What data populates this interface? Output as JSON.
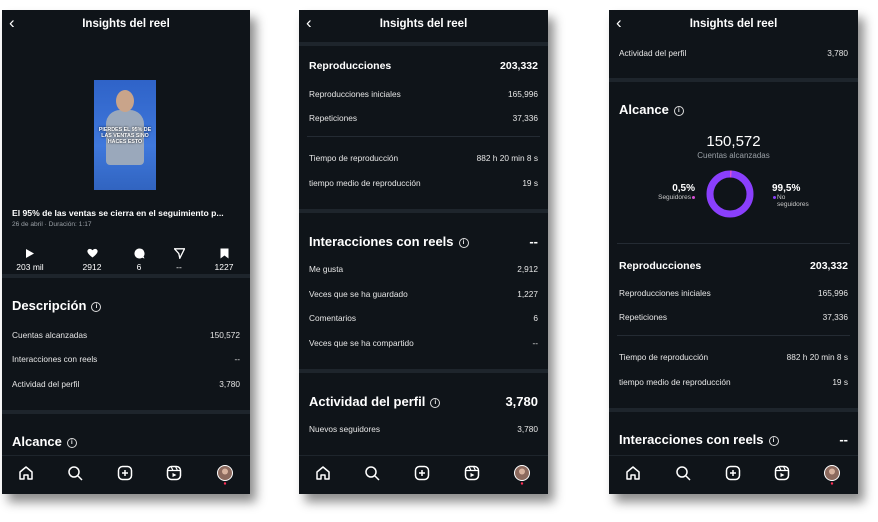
{
  "screen_title": "Insights del reel",
  "icons": {
    "back": "chevron-left-icon",
    "home": "home-icon",
    "search": "search-icon",
    "create": "plus-square-icon",
    "reels": "reels-icon",
    "profile": "avatar"
  },
  "colors": {
    "background": "#0f1419",
    "accent": "#8a3ffc",
    "dot": "#d64fd6"
  },
  "reel": {
    "thumbnail_caption": "PIERDES EL 95% DE LAS VENTAS SINO HACES ESTO",
    "headline": "El 95% de las ventas se cierra en el seguimiento p...",
    "meta": "26 de abril · Duración: 1:17",
    "stats": [
      {
        "icon": "play-icon",
        "value": "203 mil"
      },
      {
        "icon": "heart-icon",
        "value": "2912"
      },
      {
        "icon": "comment-icon",
        "value": "6"
      },
      {
        "icon": "share-icon",
        "value": "--"
      },
      {
        "icon": "bookmark-icon",
        "value": "1227"
      }
    ]
  },
  "descripcion": {
    "title": "Descripción",
    "rows": [
      {
        "label": "Cuentas alcanzadas",
        "value": "150,572"
      },
      {
        "label": "Interacciones con reels",
        "value": "--"
      },
      {
        "label": "Actividad del perfil",
        "value": "3,780"
      }
    ]
  },
  "alcance": {
    "title": "Alcance",
    "number": "150,572",
    "subtitle": "Cuentas alcanzadas",
    "followers_pct": "0,5%",
    "followers_label": "Seguidores",
    "non_followers_pct": "99,5%",
    "non_followers_label_1": "No",
    "non_followers_label_2": "seguidores",
    "followers_share": 0.005
  },
  "reproducciones": {
    "title": "Reproducciones",
    "value": "203,332",
    "rows": [
      {
        "label": "Reproducciones iniciales",
        "value": "165,996"
      },
      {
        "label": "Repeticiones",
        "value": "37,336"
      }
    ],
    "time_rows": [
      {
        "label": "Tiempo de reproducción",
        "value": "882 h 20 min 8 s"
      },
      {
        "label": "tiempo medio de reproducción",
        "value": "19 s"
      }
    ]
  },
  "interacciones": {
    "title": "Interacciones con reels",
    "value": "--",
    "rows": [
      {
        "label": "Me gusta",
        "value": "2,912"
      },
      {
        "label": "Veces que se ha guardado",
        "value": "1,227"
      },
      {
        "label": "Comentarios",
        "value": "6"
      },
      {
        "label": "Veces que se ha compartido",
        "value": "--"
      }
    ]
  },
  "actividad": {
    "title": "Actividad del perfil",
    "value": "3,780",
    "rows": [
      {
        "label": "Nuevos seguidores",
        "value": "3,780"
      }
    ],
    "top_label": "Actividad del perfil",
    "top_value": "3,780"
  }
}
